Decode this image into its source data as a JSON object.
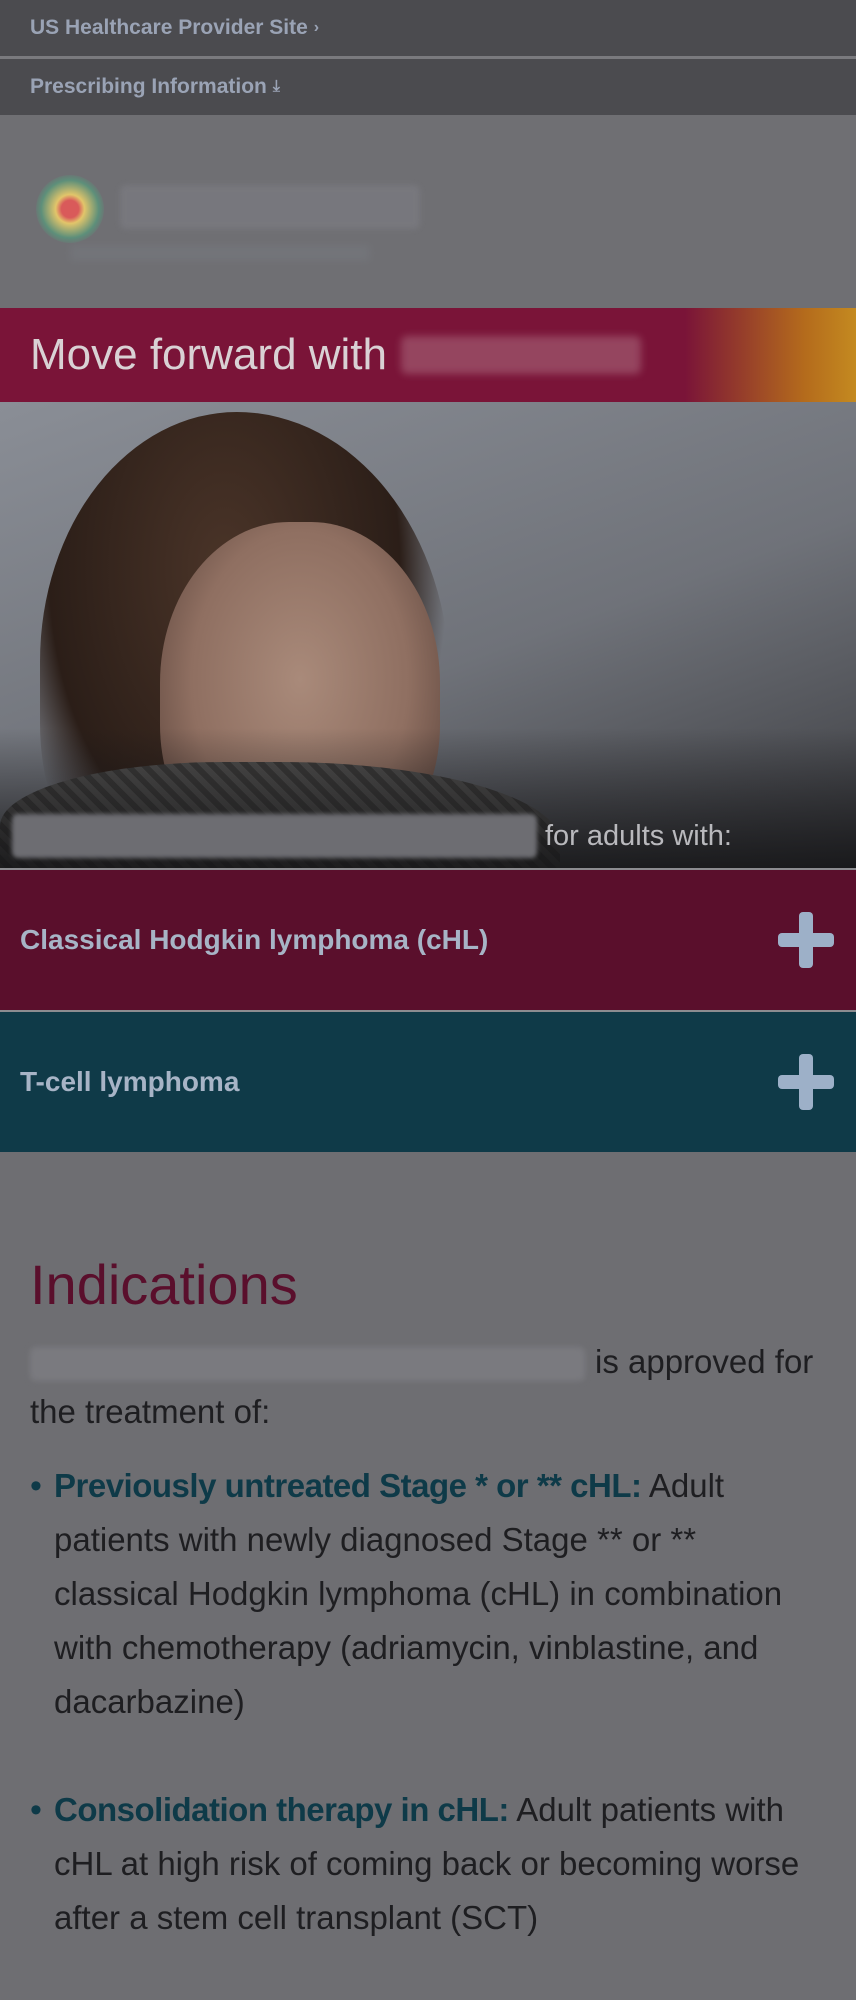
{
  "nav": {
    "provider_link": "US Healthcare Provider Site",
    "provider_chevron": "›",
    "prescribing_link": "Prescribing Information",
    "download_icon": "⤓"
  },
  "logo": {
    "icon": "brand-logo-icon"
  },
  "hero": {
    "headline": "Move forward with"
  },
  "photo": {
    "caption": "for adults with:"
  },
  "accordions": [
    {
      "label": "Classical Hodgkin lymphoma (cHL)",
      "color": "#5a0f2c"
    },
    {
      "label": "T-cell lymphoma",
      "color": "#0f3a48"
    }
  ],
  "indications": {
    "title": "Indications",
    "intro": "is approved for the treatment of:",
    "items": [
      {
        "heading": "Previously untreated Stage * or ** cHL:",
        "text": "Adult patients with newly diagnosed Stage ** or ** classical Hodgkin lymphoma (cHL) in combination with chemotherapy (adriamycin, vinblastine, and dacarbazine)"
      },
      {
        "heading": "Consolidation therapy in cHL:",
        "text": "Adult patients with cHL at high risk of coming back or becoming worse after a stem cell transplant (SCT)"
      }
    ]
  },
  "colors": {
    "brand_maroon": "#5a0f2c",
    "brand_teal": "#0f3a48"
  }
}
